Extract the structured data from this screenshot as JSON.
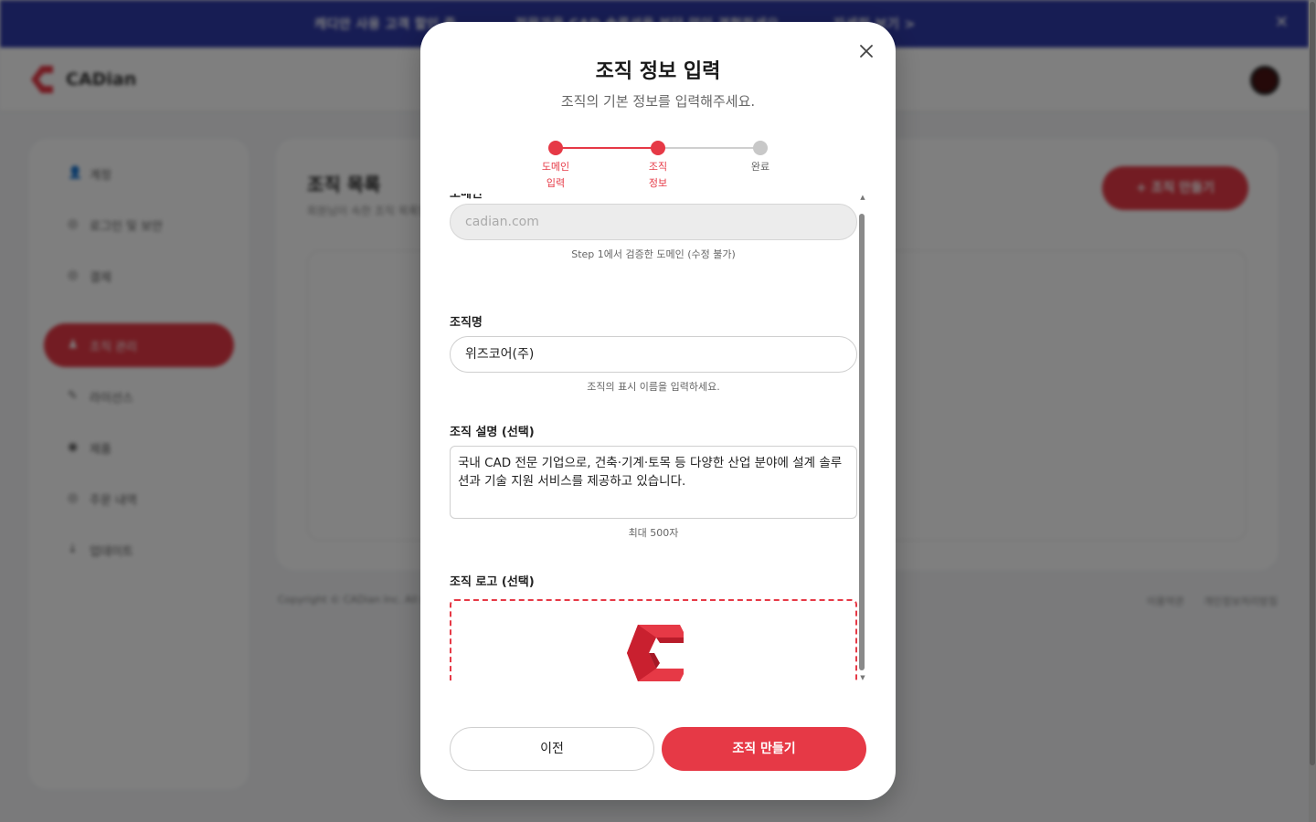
{
  "banner": {
    "segment_1": "캐디안 사용 고객 할인 중",
    "segment_2": "전문가용 CAD 솔루션을 부담 없이 경험하세요",
    "segment_3": "자세히 보기 >"
  },
  "header": {
    "logo_text": "CADian"
  },
  "sidebar": {
    "items": [
      {
        "label": "계정"
      },
      {
        "label": "로그인 및 보안"
      },
      {
        "label": "결제"
      },
      {
        "label": "조직 관리"
      },
      {
        "label": "라이선스"
      },
      {
        "label": "제품"
      },
      {
        "label": "주문 내역"
      },
      {
        "label": "업데이트"
      }
    ]
  },
  "main": {
    "title": "조직 목록",
    "subtitle": "회원님이 속한 조직 목록입니다.",
    "create_button": "+ 조직 만들기"
  },
  "footer": {
    "copyright": "Copyright © CADian Inc. All rights reserved.",
    "link_1": "이용약관",
    "link_2": "개인정보처리방침"
  },
  "modal": {
    "title": "조직 정보 입력",
    "subtitle": "조직의 기본 정보를 입력해주세요.",
    "stepper": {
      "steps": [
        {
          "line1": "도메인",
          "line2": "입력",
          "state": "done"
        },
        {
          "line1": "조직",
          "line2": "정보",
          "state": "current"
        },
        {
          "line1": "완료",
          "line2": "",
          "state": "pending"
        }
      ]
    },
    "domain": {
      "label": "도메인",
      "value": "cadian.com",
      "help": "Step 1에서 검증한 도메인 (수정 불가)"
    },
    "org_name": {
      "label": "조직명",
      "value": "위즈코어(주)",
      "help": "조직의 표시 이름을 입력하세요."
    },
    "org_desc": {
      "label": "조직 설명 (선택)",
      "value": "국내 CAD 전문 기업으로, 건축·기계·토목 등 다양한 산업 분야에 설계 솔루션과 기술 지원 서비스를 제공하고 있습니다.",
      "help": "최대 500자"
    },
    "org_logo": {
      "label": "조직 로고 (선택)"
    },
    "buttons": {
      "prev": "이전",
      "create": "조직 만들기"
    }
  },
  "colors": {
    "accent": "#e63946",
    "banner": "#2f3aa8",
    "step_pending": "#c8c8c8"
  }
}
